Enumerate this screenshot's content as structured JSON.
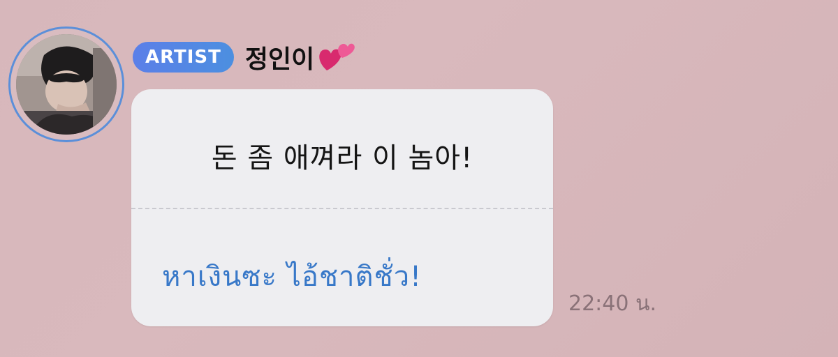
{
  "message": {
    "badge_label": "ARTIST",
    "sender_name": "정인이",
    "name_emoji": "heart-emoji-icon",
    "original_text": "돈 좀 애껴라 이 놈아!",
    "translated_text": "หาเงินซะ ไอ้ชาติชั่ว!",
    "timestamp": "22:40 น."
  },
  "colors": {
    "background": "#d8b8bc",
    "badge": "#5b7fe8",
    "avatar_ring": "#5b8fd9",
    "bubble": "#eeeef1",
    "translation_text": "#3878c8",
    "timestamp_text": "#8a7278",
    "heart": "#e0307a"
  }
}
